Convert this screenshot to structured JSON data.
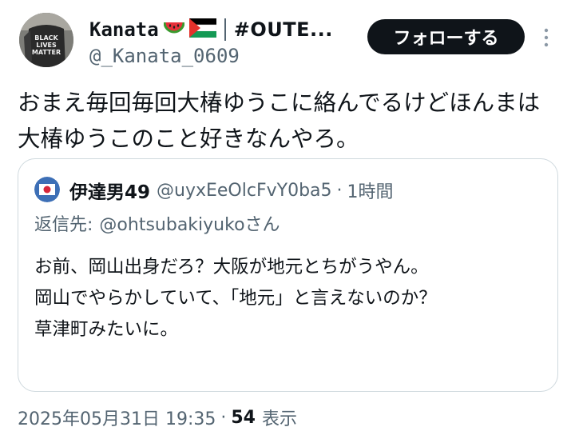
{
  "author": {
    "display_name": "Kanata",
    "emoji_flags": [
      "watermelon-icon",
      "palestine-flag-icon"
    ],
    "hashtag": "#OUTE...",
    "handle": "@_Kanata_0609",
    "avatar_shirt_text": [
      "BLACK",
      "LIVES",
      "MATTER"
    ]
  },
  "actions": {
    "follow_label": "フォローする",
    "more_icon": "more-vertical-icon"
  },
  "tweet": {
    "text": "おまえ毎回毎回大椿ゆうこに絡んでるけどほんまは大椿ゆうこのこと好きなんやろ。"
  },
  "quote": {
    "display_name": "伊達男49",
    "handle": "@uyxEeOlcFvY0ba5",
    "dot": "·",
    "time": "1時間",
    "reply_label": "返信先:",
    "reply_to": "@ohtsubakiyukoさん",
    "lines": [
      "お前、岡山出身だろ？大阪が地元とちがうやん。",
      "岡山でやらかしていて、「地元」と言えないのか？",
      "草津町みたいに。"
    ]
  },
  "meta": {
    "datetime": "2025年05月31日 19:35",
    "dot": "·",
    "views_count": "54",
    "views_label": "表示"
  },
  "colors": {
    "text": "#0f1419",
    "secondary": "#536471",
    "border": "#cfd9de",
    "button_bg": "#0f1419"
  }
}
